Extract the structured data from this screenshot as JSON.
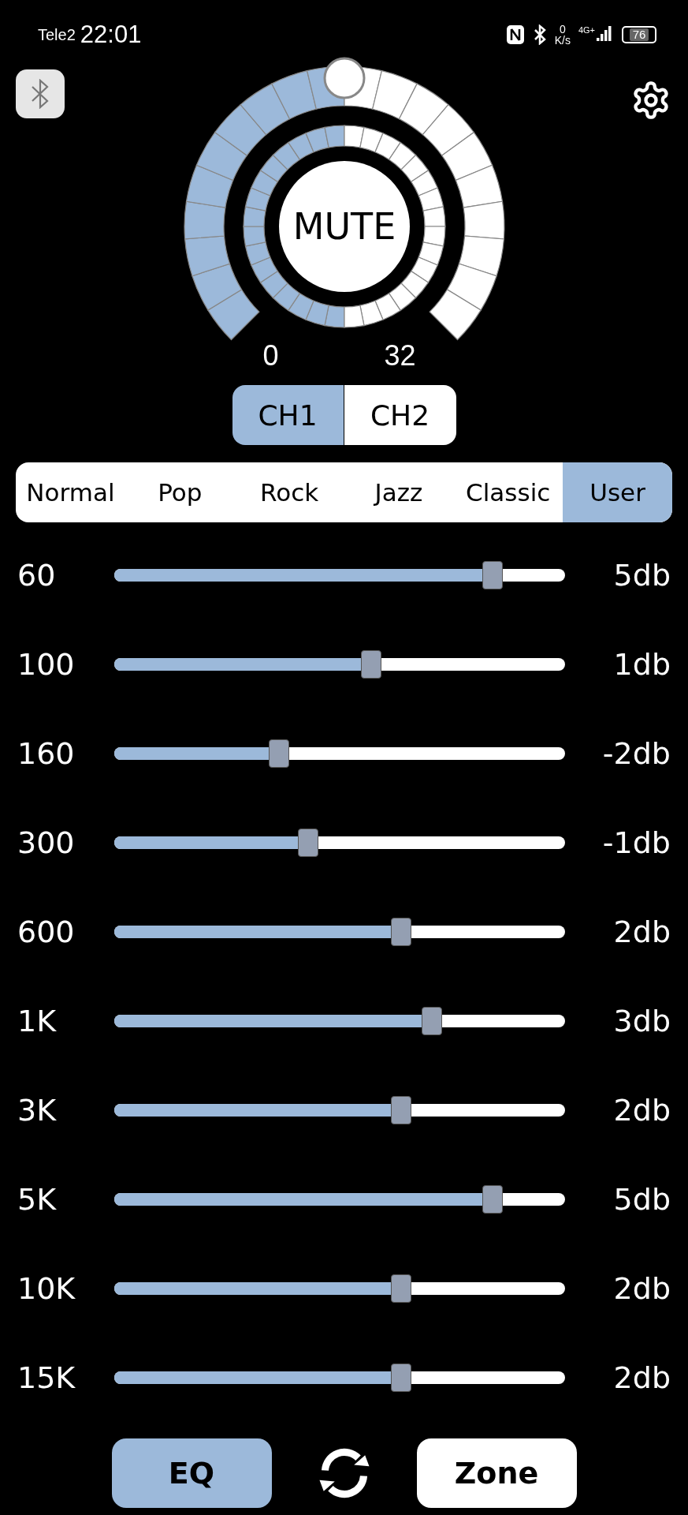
{
  "status_bar": {
    "carrier": "Tele2",
    "time": "22:01",
    "speed_value": "0",
    "speed_unit": "K/s",
    "network": "4G+",
    "battery": "76"
  },
  "dial": {
    "center_label": "MUTE",
    "min_label": "0",
    "max_label": "32"
  },
  "channels": [
    {
      "label": "CH1",
      "selected": true
    },
    {
      "label": "CH2",
      "selected": false
    }
  ],
  "presets": [
    {
      "label": "Normal",
      "selected": false
    },
    {
      "label": "Pop",
      "selected": false
    },
    {
      "label": "Rock",
      "selected": false
    },
    {
      "label": "Jazz",
      "selected": false
    },
    {
      "label": "Classic",
      "selected": false
    },
    {
      "label": "User",
      "selected": true
    }
  ],
  "bands": [
    {
      "frequency": "60",
      "level": 0.84,
      "reading": "5db"
    },
    {
      "frequency": "100",
      "level": 0.57,
      "reading": "1db"
    },
    {
      "frequency": "160",
      "level": 0.366,
      "reading": "-2db"
    },
    {
      "frequency": "300",
      "level": 0.43,
      "reading": "-1db"
    },
    {
      "frequency": "600",
      "level": 0.636,
      "reading": "2db"
    },
    {
      "frequency": "1K",
      "level": 0.704,
      "reading": "3db"
    },
    {
      "frequency": "3K",
      "level": 0.636,
      "reading": "2db"
    },
    {
      "frequency": "5K",
      "level": 0.84,
      "reading": "5db"
    },
    {
      "frequency": "10K",
      "level": 0.636,
      "reading": "2db"
    },
    {
      "frequency": "15K",
      "level": 0.636,
      "reading": "2db"
    }
  ],
  "bottom_bar": [
    {
      "label": "EQ",
      "selected": true
    },
    {
      "label": "Zone",
      "selected": false
    }
  ]
}
